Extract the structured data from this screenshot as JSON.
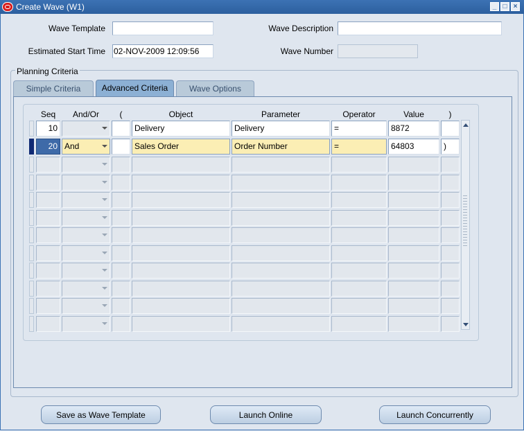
{
  "window": {
    "title": "Create Wave (W1)"
  },
  "header": {
    "wave_template_label": "Wave Template",
    "wave_template_value": "",
    "wave_description_label": "Wave Description",
    "wave_description_value": "",
    "estimated_start_label": "Estimated Start Time",
    "estimated_start_value": "02-NOV-2009 12:09:56",
    "wave_number_label": "Wave Number",
    "wave_number_value": ""
  },
  "planning": {
    "group_title": "Planning Criteria",
    "tabs": [
      {
        "label": "Simple Criteria",
        "active": false
      },
      {
        "label": "Advanced Criteria",
        "active": true
      },
      {
        "label": "Wave Options",
        "active": false
      }
    ],
    "columns": {
      "seq": "Seq",
      "andor": "And/Or",
      "lparen": "(",
      "object": "Object",
      "parameter": "Parameter",
      "operator": "Operator",
      "value": "Value",
      "rparen": ")"
    },
    "rows": [
      {
        "seq": "10",
        "andor": "",
        "lparen": "",
        "object": "Delivery",
        "parameter": "Delivery",
        "operator": "=",
        "value": "8872",
        "rparen": ""
      },
      {
        "seq": "20",
        "andor": "And",
        "lparen": "",
        "object": "Sales Order",
        "parameter": "Order Number",
        "operator": "=",
        "value": "64803",
        "rparen": ")"
      }
    ]
  },
  "buttons": {
    "save_template": "Save as Wave Template",
    "launch_online": "Launch Online",
    "launch_concurrently": "Launch Concurrently"
  },
  "colors": {
    "title_bar": "#2c5f9e",
    "current_row": "#fbeeb4",
    "record_indicator": "#102a74"
  }
}
